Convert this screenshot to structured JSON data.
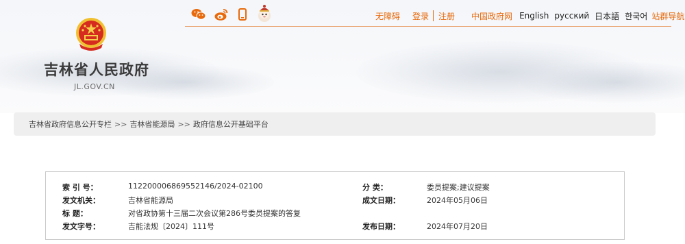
{
  "header": {
    "site_title": "吉林省人民政府",
    "site_domain": "JL.GOV.CN",
    "social_icons": [
      "wechat-icon",
      "weibo-icon",
      "mobile-icon",
      "robot-avatar-icon"
    ],
    "nav": {
      "accessibility": "无障碍",
      "login": "登录",
      "register": "注册",
      "gov_portal": "中国政府网",
      "english": "English",
      "russian": "русский",
      "japanese": "日本語",
      "korean": "한국어",
      "site_nav": "站群导航"
    },
    "accent_color": "#e86a0c"
  },
  "breadcrumb": {
    "items": [
      "吉林省政府信息公开专栏",
      "吉林省能源局",
      "政府信息公开基础平台"
    ],
    "separator": ">>"
  },
  "document_meta": {
    "index_label": "索 引 号：",
    "index_value": "112200006869552146/2024-02100",
    "category_label": "分    类：",
    "category_value": "委员提案;建议提案",
    "issuer_label": "发文机关：",
    "issuer_value": "吉林省能源局",
    "date_written_label": "成文日期：",
    "date_written_value": "2024年05月06日",
    "title_label": "标    题：",
    "title_value": "对省政协第十三届二次会议第286号委员提案的答复",
    "doc_number_label": "发文字号：",
    "doc_number_value": "吉能法规〔2024〕111号",
    "publish_date_label": "发布日期：",
    "publish_date_value": "2024年07月20日"
  }
}
